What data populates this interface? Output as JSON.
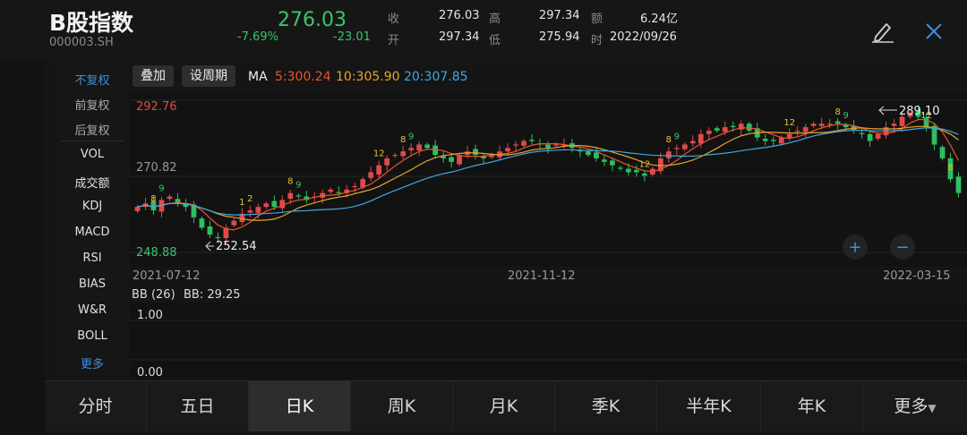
{
  "header": {
    "title": "B股指数",
    "code": "000003.SH",
    "price": "276.03",
    "change_pct": "-7.69%",
    "change": "-23.01",
    "quote": [
      {
        "label": "收",
        "value": "276.03"
      },
      {
        "label": "高",
        "value": "297.34"
      },
      {
        "label": "额",
        "value": "6.24亿"
      },
      {
        "label": "开",
        "value": "297.34"
      },
      {
        "label": "低",
        "value": "275.94"
      },
      {
        "label": "时",
        "value": "2022/09/26"
      }
    ]
  },
  "side_menu": {
    "fq": [
      {
        "label": "不复权"
      },
      {
        "label": "前复权"
      },
      {
        "label": "后复权"
      }
    ],
    "indicators": [
      {
        "label": "VOL"
      },
      {
        "label": "成交额"
      },
      {
        "label": "KDJ"
      },
      {
        "label": "MACD"
      },
      {
        "label": "RSI"
      },
      {
        "label": "BIAS"
      },
      {
        "label": "W&R"
      },
      {
        "label": "BOLL"
      }
    ],
    "more": "更多"
  },
  "toolbar": {
    "overlay": "叠加",
    "period": "设周期",
    "ma_label": "MA",
    "ma": [
      {
        "text": "5:300.24",
        "color": "#e8542f"
      },
      {
        "text": "10:305.90",
        "color": "#e8a42f"
      },
      {
        "text": "20:307.85",
        "color": "#3fa9e0"
      }
    ]
  },
  "chart_data": {
    "type": "candlestick",
    "price_ticks": [
      "292.76",
      "270.82",
      "248.88"
    ],
    "ylim": [
      248.88,
      292.76
    ],
    "x_ticks": [
      "2021-07-12",
      "2021-11-12",
      "2022-03-15"
    ],
    "annotations": {
      "max": "289.10",
      "min": "252.54"
    },
    "closes": [
      262,
      263,
      261,
      264,
      265,
      263,
      262,
      259,
      256,
      254,
      253,
      256,
      258,
      260,
      261,
      262,
      263,
      262,
      264,
      266,
      265,
      264,
      265,
      266,
      267,
      266,
      267,
      268,
      270,
      272,
      274,
      276,
      277,
      278,
      279,
      280,
      279,
      277,
      276,
      275,
      277,
      278,
      277,
      276,
      277,
      278,
      279,
      280,
      281,
      281,
      280,
      279,
      280,
      280,
      279,
      278,
      277,
      276,
      275,
      274,
      273,
      272,
      272,
      271,
      273,
      276,
      278,
      279,
      280,
      281,
      283,
      284,
      284,
      285,
      285,
      286,
      284,
      282,
      281,
      281,
      282,
      283,
      284,
      285,
      286,
      286,
      286,
      286,
      285,
      284,
      283,
      281,
      283,
      285,
      286,
      288,
      289,
      288,
      285,
      280,
      276,
      270,
      266
    ],
    "ma_lines": [
      {
        "name": "MA5",
        "color": "#e8542f"
      },
      {
        "name": "MA10",
        "color": "#e8a42f"
      },
      {
        "name": "MA20",
        "color": "#3fa9e0"
      }
    ],
    "td_labels": [
      {
        "i": 2,
        "t": "8",
        "c": "#e8c22f"
      },
      {
        "i": 3,
        "t": "9",
        "c": "#3cc46c"
      },
      {
        "i": 13,
        "t": "1",
        "c": "#e8c22f"
      },
      {
        "i": 14,
        "t": "2",
        "c": "#e8c22f"
      },
      {
        "i": 19,
        "t": "8",
        "c": "#e8c22f"
      },
      {
        "i": 20,
        "t": "9",
        "c": "#3cc46c"
      },
      {
        "i": 33,
        "t": "8",
        "c": "#e8c22f"
      },
      {
        "i": 34,
        "t": "9",
        "c": "#3cc46c"
      },
      {
        "i": 30,
        "t": "12",
        "c": "#e8c22f"
      },
      {
        "i": 66,
        "t": "8",
        "c": "#e8c22f"
      },
      {
        "i": 67,
        "t": "9",
        "c": "#3cc46c"
      },
      {
        "i": 63,
        "t": "12",
        "c": "#e8c22f"
      },
      {
        "i": 81,
        "t": "12",
        "c": "#e8c22f"
      },
      {
        "i": 87,
        "t": "8",
        "c": "#e8c22f"
      },
      {
        "i": 88,
        "t": "9",
        "c": "#3cc46c"
      },
      {
        "i": 98,
        "t": "12",
        "c": "#e8c22f"
      },
      {
        "i": 101,
        "t": "8",
        "c": "#e8c22f"
      },
      {
        "i": 102,
        "t": "9",
        "c": "#3cc46c"
      }
    ]
  },
  "sub_indicator": {
    "name": "BB (26)",
    "value_text": "BB: 29.25",
    "ticks": [
      "1.00",
      "0.00"
    ]
  },
  "zoom": {
    "plus": "+",
    "minus": "−"
  },
  "bottom_tabs": [
    {
      "label": "分时"
    },
    {
      "label": "五日"
    },
    {
      "label": "日K"
    },
    {
      "label": "周K"
    },
    {
      "label": "月K"
    },
    {
      "label": "季K"
    },
    {
      "label": "半年K"
    },
    {
      "label": "年K"
    },
    {
      "label": "更多"
    }
  ]
}
